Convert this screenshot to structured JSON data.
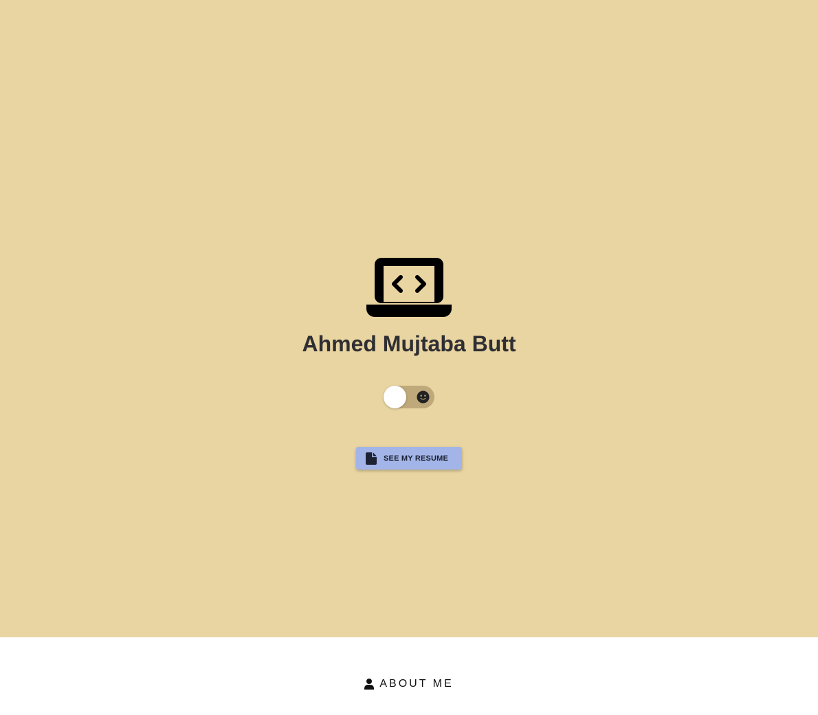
{
  "hero": {
    "name": "Ahmed Mujtaba Butt",
    "icon": "laptop-code-icon",
    "background_color": "#e9d5a1",
    "theme_toggle": {
      "state": "light",
      "icon": "moon-face-icon"
    },
    "resume_button": {
      "label": "SEE MY RESUME",
      "icon": "document-icon",
      "color": "#a3b5e8"
    }
  },
  "about": {
    "icon": "user-icon",
    "heading": "ABOUT ME"
  }
}
